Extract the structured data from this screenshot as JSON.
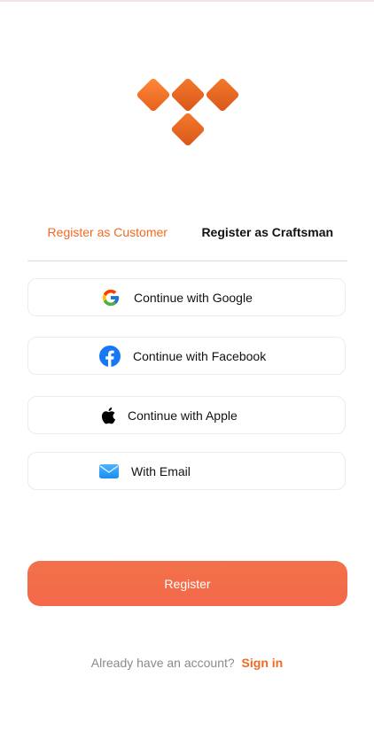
{
  "colors": {
    "accent": "#f16a1f",
    "register_button": "#f36c4b",
    "logo_orange": "#ee6a22"
  },
  "logo": {
    "icon": "diamond-grid-logo-icon"
  },
  "tabs": [
    {
      "label": "Register as Customer",
      "active": true
    },
    {
      "label": "Register as Craftsman",
      "active": false
    }
  ],
  "social": {
    "google": {
      "label": "Continue with Google",
      "icon": "google-icon"
    },
    "facebook": {
      "label": "Continue with Facebook",
      "icon": "facebook-icon"
    },
    "apple": {
      "label": "Continue with Apple",
      "icon": "apple-icon"
    },
    "email": {
      "label": "With Email",
      "icon": "mail-icon"
    }
  },
  "register": {
    "label": "Register"
  },
  "footer": {
    "question": "Already have an account?",
    "signin_label": "Sign in"
  }
}
